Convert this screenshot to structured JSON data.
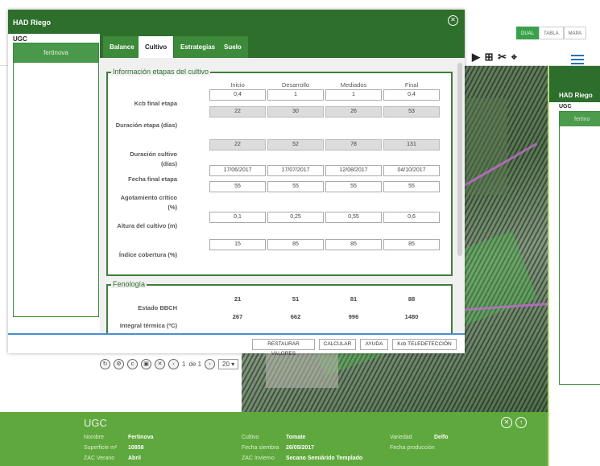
{
  "app_title": "HAD Riego",
  "view_toggle": [
    "DUAL",
    "TABLA",
    "MAPA"
  ],
  "ugc": {
    "label": "UGC",
    "items": [
      "fertinova"
    ]
  },
  "tabs": [
    {
      "label": "Balance",
      "active": false
    },
    {
      "label": "Cultivo",
      "active": true
    },
    {
      "label": "Estrategias",
      "active": false
    },
    {
      "label": "Suelo",
      "active": false
    }
  ],
  "stages": {
    "legend": "Información etapas del cultivo",
    "columns": [
      "Inicio",
      "Desarrollo",
      "Mediados",
      "Final"
    ],
    "rows": [
      {
        "label": "Kcb final etapa",
        "values": [
          "0,4",
          "1",
          "1",
          "0,4"
        ],
        "readonly": false
      },
      {
        "label": "Duración etapa (días)",
        "values": [
          "22",
          "30",
          "26",
          "53"
        ],
        "readonly": true
      },
      {
        "label": "Duración cultivo (días)",
        "values": [
          "22",
          "52",
          "78",
          "131"
        ],
        "readonly": true
      },
      {
        "label": "Fecha final etapa",
        "values": [
          "17/06/2017",
          "17/07/2017",
          "12/08/2017",
          "04/10/2017"
        ],
        "readonly": false
      },
      {
        "label": "Agotamiento crítico (%)",
        "values": [
          "55",
          "55",
          "55",
          "55"
        ],
        "readonly": false
      },
      {
        "label": "Altura del cultivo (m)",
        "values": [
          "0,1",
          "0,25",
          "0,55",
          "0,6"
        ],
        "readonly": false
      },
      {
        "label": "Índice cobertura (%)",
        "values": [
          "15",
          "85",
          "85",
          "85"
        ],
        "readonly": false
      }
    ]
  },
  "phenology": {
    "legend": "Fenología",
    "rows": [
      {
        "label": "Estado BBCH",
        "values": [
          "21",
          "51",
          "81",
          "88"
        ]
      },
      {
        "label": "Integral térmica (ºC)",
        "values": [
          "267",
          "662",
          "996",
          "1480"
        ]
      }
    ]
  },
  "footer_buttons": [
    "RESTAURAR VALORES",
    "CALCULAR",
    "AYUDA",
    "Kcb TELEDETECCIÓN"
  ],
  "pager": {
    "page": "1",
    "of_text": "de 1",
    "page_size": "20"
  },
  "info_panel": {
    "title": "UGC",
    "fields": [
      {
        "label": "Nombre",
        "value": "Fertinova"
      },
      {
        "label": "Superficie m²",
        "value": "10858"
      },
      {
        "label": "ZAC Verano",
        "value": "Abril"
      },
      {
        "label": "Cultivo",
        "value": "Tomate"
      },
      {
        "label": "Fecha siembra",
        "value": "26/05/2017"
      },
      {
        "label": "ZAC Invierno",
        "value": "Secano Semiárido Templado"
      },
      {
        "label": "Variedad",
        "value": "Delfo"
      },
      {
        "label": "Fecha producción",
        "value": ""
      }
    ]
  },
  "secondary_window": {
    "title": "HAD Riego",
    "ugc_label": "UGC",
    "item": "fertino"
  },
  "colors": {
    "header_green": "#2e6f2c",
    "accent_green": "#3aa14b",
    "panel_green": "#5fa83d",
    "footer_blue": "#4a8fd1"
  }
}
